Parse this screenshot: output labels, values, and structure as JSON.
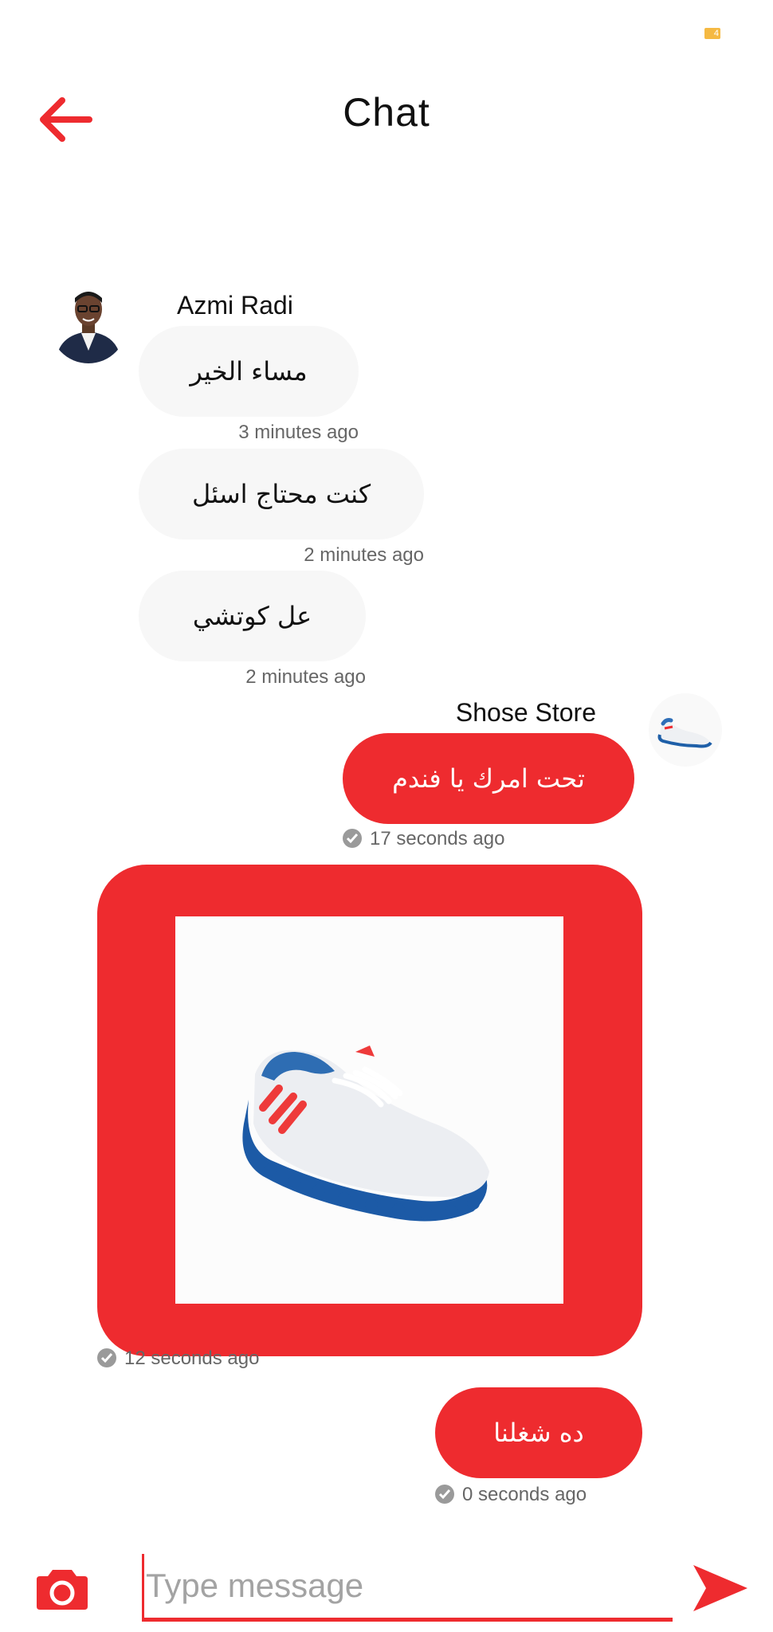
{
  "status": {
    "battery_label": "4"
  },
  "header": {
    "title": "Chat",
    "back_icon": "arrow-left-icon"
  },
  "incoming": {
    "sender": "Azmi Radi",
    "messages": [
      {
        "text": "مساء الخير",
        "time": "3 minutes ago"
      },
      {
        "text": "كنت محتاج اسئل",
        "time": "2 minutes ago"
      },
      {
        "text": "عل كوتشي",
        "time": "2 minutes ago"
      }
    ]
  },
  "outgoing": {
    "sender": "Shose Store",
    "messages": [
      {
        "text": "تحت امرك يا فندم",
        "time": "17 seconds ago"
      },
      {
        "image": "sneaker-photo",
        "time": "12 seconds ago"
      },
      {
        "text": "ده شغلنا",
        "time": "0 seconds ago"
      }
    ]
  },
  "composer": {
    "placeholder": "Type message",
    "camera_icon": "camera-icon",
    "send_icon": "send-icon"
  },
  "colors": {
    "accent": "#ee2b2f",
    "incoming_bubble": "#f7f7f7",
    "meta_text": "#666666"
  }
}
